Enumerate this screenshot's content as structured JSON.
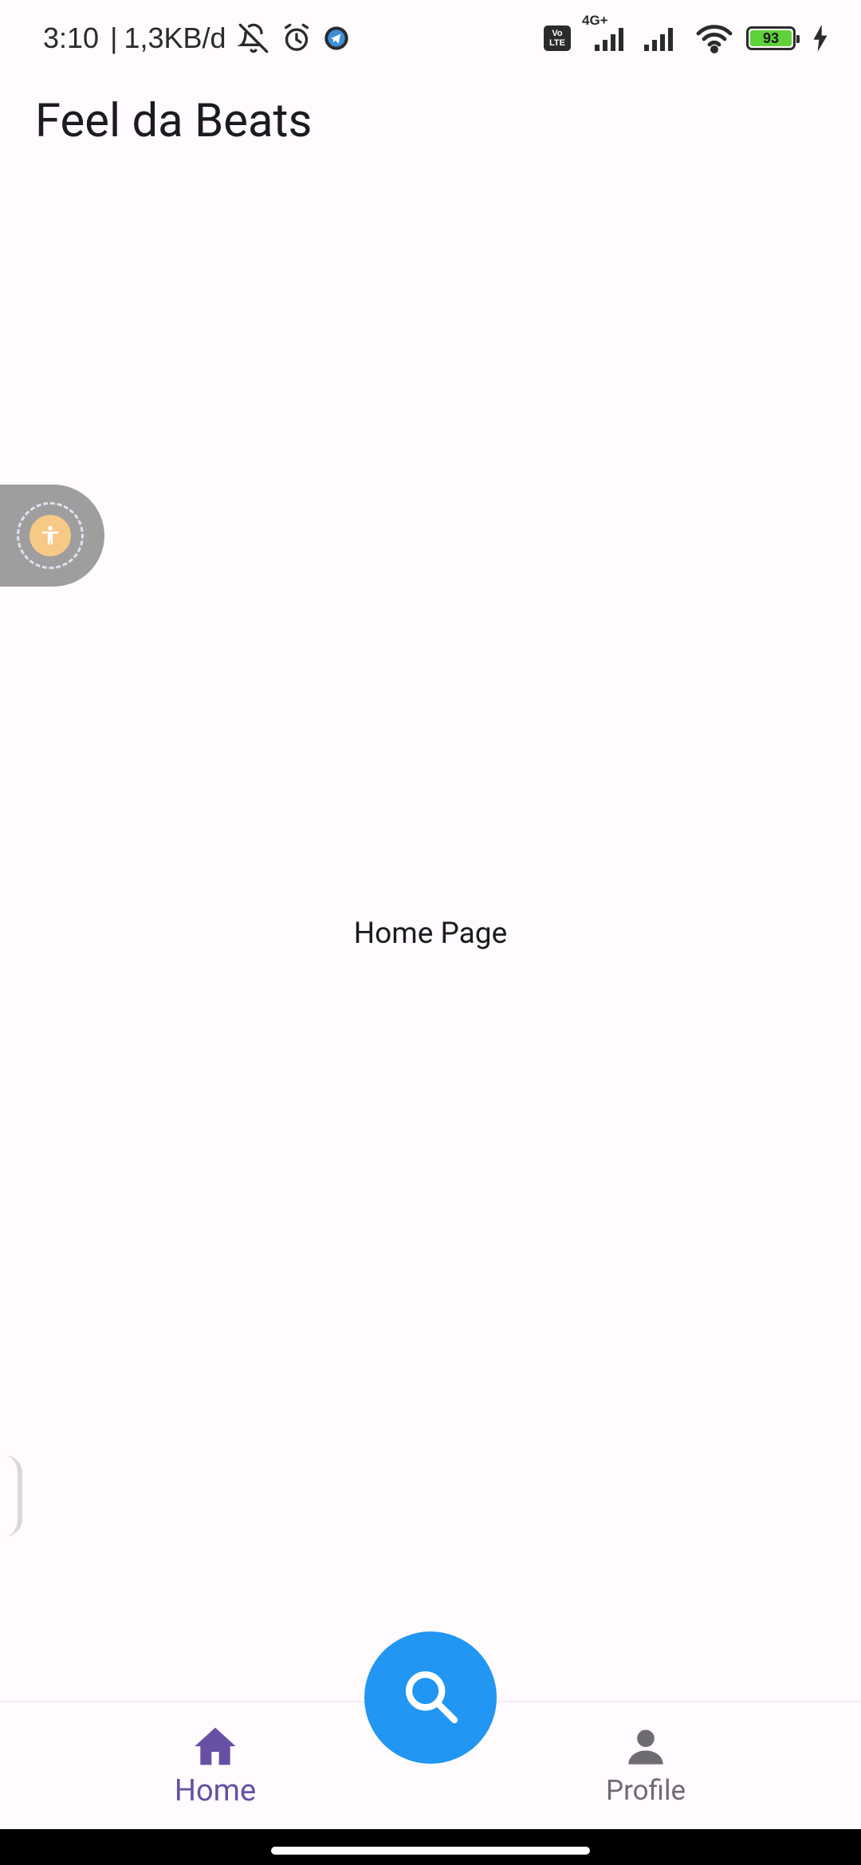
{
  "status_bar": {
    "time": "3:10",
    "separator": "|",
    "data_rate": "1,3KB/d",
    "icons": [
      "bell-off-icon",
      "alarm-icon",
      "telegram-icon",
      "volte-icon",
      "signal-icon",
      "signal-icon",
      "wifi-icon",
      "battery-icon",
      "charging-icon"
    ],
    "volte_line1": "Vo",
    "volte_line2": "LTE",
    "network_type": "4G+",
    "battery_level": "93",
    "battery_color": "#5fd13a"
  },
  "app_bar": {
    "title": "Feel da Beats"
  },
  "body": {
    "text": "Home Page"
  },
  "bottom_nav": {
    "items": [
      {
        "label": "Home",
        "icon": "home-icon",
        "selected": true
      },
      {
        "label": "Profile",
        "icon": "person-icon",
        "selected": false
      }
    ],
    "fab_icon": "search-icon"
  },
  "colors": {
    "background": "#fffbfe",
    "accent": "#6750a4",
    "fab": "#2196f3",
    "inactive": "#6f6b73"
  }
}
